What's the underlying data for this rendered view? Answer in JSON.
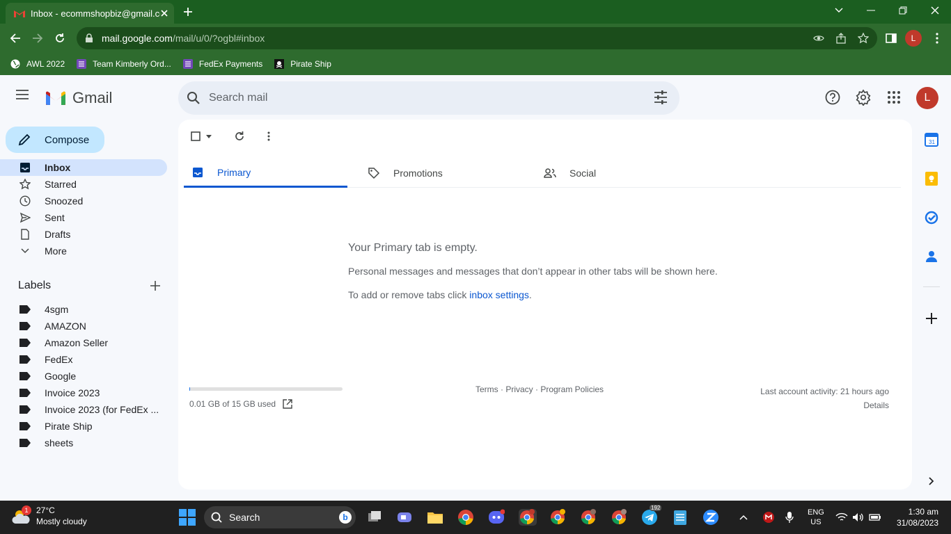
{
  "browser": {
    "tab_title": "Inbox - ecommshopbiz@gmail.com",
    "url_host": "mail.google.com",
    "url_path": "/mail/u/0/?ogbl#inbox",
    "profile_initial": "L",
    "bookmarks": [
      "AWL 2022",
      "Team Kimberly Ord...",
      "FedEx Payments",
      "Pirate Ship"
    ]
  },
  "gmail": {
    "logo_text": "Gmail",
    "search_placeholder": "Search mail",
    "avatar_initial": "L",
    "compose_label": "Compose",
    "nav": [
      "Inbox",
      "Starred",
      "Snoozed",
      "Sent",
      "Drafts",
      "More"
    ],
    "labels_title": "Labels",
    "labels": [
      "4sgm",
      "AMAZON",
      "Amazon Seller",
      "FedEx",
      "Google",
      "Invoice 2023",
      "Invoice 2023 (for FedEx ...",
      "Pirate Ship",
      "sheets"
    ],
    "tabs": [
      "Primary",
      "Promotions",
      "Social"
    ],
    "empty_title": "Your Primary tab is empty.",
    "empty_desc": "Personal messages and messages that don’t appear in other tabs will be shown here.",
    "empty_hint_prefix": "To add or remove tabs click ",
    "empty_hint_link": "inbox settings",
    "empty_hint_suffix": ".",
    "storage_text": "0.01 GB of 15 GB used",
    "storage_fraction": 0.001,
    "footer_links": "Terms · Privacy · Program Policies",
    "last_activity": "Last account activity: 21 hours ago",
    "details_link": "Details"
  },
  "taskbar": {
    "weather_badge": "1",
    "weather_temp": "27°C",
    "weather_desc": "Mostly cloudy",
    "search_label": "Search",
    "telegram_badge": "192",
    "lang_line1": "ENG",
    "lang_line2": "US",
    "time": "1:30 am",
    "date": "31/08/2023"
  },
  "colors": {
    "chrome_green": "#2e6b2e",
    "gmail_blue": "#0b57d0",
    "compose_bg": "#c2e7ff",
    "avatar": "#c0392b"
  }
}
